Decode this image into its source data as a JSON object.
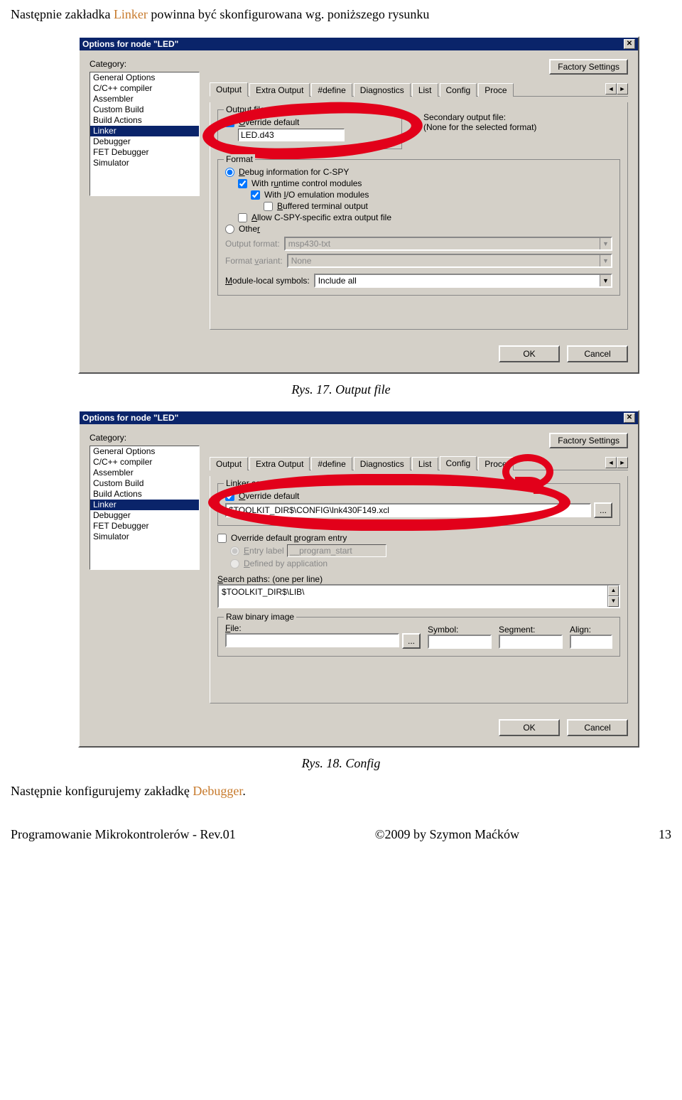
{
  "intro": {
    "pre": "Następnie zakładka ",
    "linker": "Linker",
    "post": " powinna być skonfigurowana wg. poniższego rysunku"
  },
  "caption1": "Rys. 17. Output file",
  "caption2": "Rys. 18. Config",
  "next_debugger": {
    "pre": "Następnie konfigurujemy zakładkę ",
    "link": "Debugger",
    "post": "."
  },
  "footer": {
    "left": "Programowanie Mikrokontrolerów - Rev.01",
    "mid": "©2009  by  Szymon Maćków",
    "right": "13"
  },
  "dialog": {
    "title": "Options for node \"LED\"",
    "category_label": "Category:",
    "categories": [
      "General Options",
      "C/C++ compiler",
      "Assembler",
      "Custom Build",
      "Build Actions",
      "Linker",
      "Debugger",
      "FET Debugger",
      "Simulator"
    ],
    "selected_category_index": 5,
    "factory_settings": "Factory Settings",
    "tabs": [
      "Output",
      "Extra Output",
      "#define",
      "Diagnostics",
      "List",
      "Config",
      "Proce"
    ],
    "tabs2": [
      "Output",
      "Extra Output",
      "#define",
      "Diagnostics",
      "List",
      "Config",
      "Proce"
    ],
    "ok": "OK",
    "cancel": "Cancel"
  },
  "output_tab": {
    "output_file_legend": "Output file",
    "override_default": "Override default",
    "filename": "LED.d43",
    "secondary_label": "Secondary output file:",
    "secondary_note": "(None for the selected format)",
    "format_legend": "Format",
    "debug_cspy": "Debug information for C-SPY",
    "with_runtime": "With runtime control modules",
    "with_io": "With I/O emulation modules",
    "buffered": "Buffered terminal output",
    "allow_extra": "Allow C-SPY-specific extra output file",
    "other": "Other",
    "output_format": "Output format:",
    "output_format_val": "msp430-txt",
    "format_variant": "Format variant:",
    "format_variant_val": "None",
    "module_local": "Module-local symbols:",
    "module_local_val": "Include all"
  },
  "config_tab": {
    "lcf_legend": "Linker command file",
    "override_default": "Override default",
    "path": "$TOOLKIT_DIR$\\CONFIG\\lnk430F149.xcl",
    "browse": "...",
    "override_entry": "Override default program entry",
    "entry_label": "Entry label",
    "entry_val": "__program_start",
    "defined_app": "Defined by application",
    "search_paths": "Search paths:  (one per line)",
    "search_val": "$TOOLKIT_DIR$\\LIB\\",
    "raw_legend": "Raw binary image",
    "file_label": "File:",
    "symbol_label": "Symbol:",
    "segment_label": "Segment:",
    "align_label": "Align:"
  }
}
